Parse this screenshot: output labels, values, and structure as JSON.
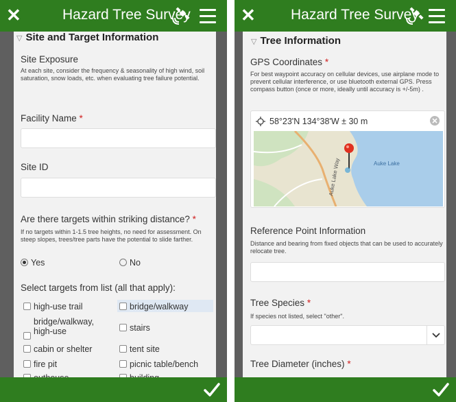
{
  "colors": {
    "header": "#2f7d1f",
    "background": "#5f5f5f",
    "form": "#f2f2f2",
    "required": "#d02020",
    "highlight": "#dfe8f3"
  },
  "app": {
    "title": "Hazard Tree Survey"
  },
  "icons": {
    "close": "close-icon",
    "satellite": "satellite-icon",
    "menu": "menu-icon",
    "submit": "checkmark-icon"
  },
  "left": {
    "section_title": "Site and Target Information",
    "site_exposure": {
      "label": "Site Exposure",
      "hint": "At each site, consider the frequency & seasonality of high wind, soil saturation, snow loads, etc. when evaluating tree failure potential."
    },
    "facility_name": {
      "label": "Facility Name",
      "required_mark": "*",
      "value": ""
    },
    "site_id": {
      "label": "Site ID",
      "value": ""
    },
    "targets_question": {
      "label": "Are there targets within striking distance?",
      "required_mark": "*",
      "hint": "If no targets within 1-1.5 tree heights, no need for assessment. On steep slopes, trees/tree parts have the potential to slide farther.",
      "options": [
        {
          "label": "Yes",
          "selected": true
        },
        {
          "label": "No",
          "selected": false
        }
      ]
    },
    "targets_list": {
      "label": "Select targets from list (all that apply):",
      "items": [
        {
          "label": "high-use trail",
          "checked": false
        },
        {
          "label": "bridge/walkway",
          "checked": false
        },
        {
          "label": "bridge/walkway,",
          "label2": "high-use",
          "checked": false
        },
        {
          "label": "stairs",
          "checked": false
        },
        {
          "label": "cabin or shelter",
          "checked": false
        },
        {
          "label": "tent site",
          "checked": false
        },
        {
          "label": "fire pit",
          "checked": false
        },
        {
          "label": "picnic table/bench",
          "checked": false
        },
        {
          "label": "outhouse",
          "checked": false
        },
        {
          "label": "building",
          "checked": false
        }
      ]
    }
  },
  "right": {
    "section_title": "Tree Information",
    "gps": {
      "label": "GPS Coordinates",
      "required_mark": "*",
      "hint": "For best waypoint accuracy on cellular devices, use airplane mode to prevent cellular interference, or use bluetooth external GPS. Press compass button (once or more, ideally until accuracy is +/-5m) .",
      "value": "58°23'N 134°38'W ± 30 m",
      "map": {
        "road_label": "Auke Lake Way",
        "lake_label": "Auke Lake"
      }
    },
    "reference_point": {
      "label": "Reference Point Information",
      "hint": "Distance and bearing from fixed objects that can be used to accurately relocate tree.",
      "value": ""
    },
    "tree_species": {
      "label": "Tree Species",
      "required_mark": "*",
      "hint": "If species not listed, select \"other\".",
      "value": ""
    },
    "tree_diameter": {
      "label": "Tree Diameter (inches)",
      "required_mark": "*"
    }
  }
}
